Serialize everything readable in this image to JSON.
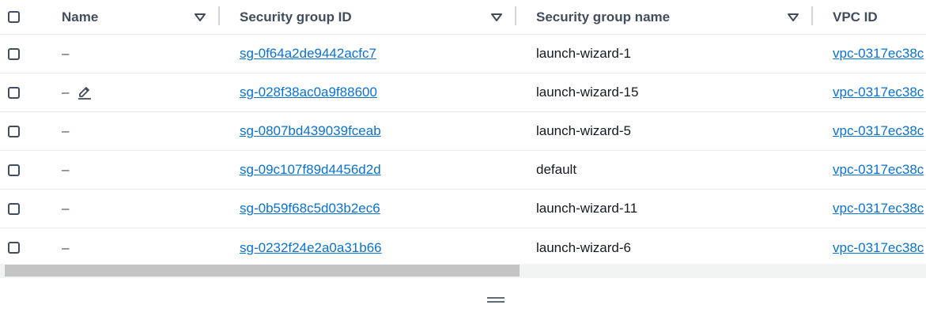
{
  "columns": {
    "name": "Name",
    "security_group_id": "Security group ID",
    "security_group_name": "Security group name",
    "vpc_id": "VPC ID"
  },
  "rows": [
    {
      "name": "–",
      "sg_id": "sg-0f64a2de9442acfc7",
      "sg_name": "launch-wizard-1",
      "vpc_id": "vpc-0317ec38c"
    },
    {
      "name": "–",
      "sg_id": "sg-028f38ac0a9f88600",
      "sg_name": "launch-wizard-15",
      "vpc_id": "vpc-0317ec38c"
    },
    {
      "name": "–",
      "sg_id": "sg-0807bd439039fceab",
      "sg_name": "launch-wizard-5",
      "vpc_id": "vpc-0317ec38c"
    },
    {
      "name": "–",
      "sg_id": "sg-09c107f89d4456d2d",
      "sg_name": "default",
      "vpc_id": "vpc-0317ec38c"
    },
    {
      "name": "–",
      "sg_id": "sg-0b59f68c5d03b2ec6",
      "sg_name": "launch-wizard-11",
      "vpc_id": "vpc-0317ec38c"
    },
    {
      "name": "–",
      "sg_id": "sg-0232f24e2a0a31b66",
      "sg_name": "launch-wizard-6",
      "vpc_id": "vpc-0317ec38c"
    }
  ],
  "icons": {
    "sort": "caret-down-icon",
    "edit": "pencil-icon",
    "resize": "drag-handle-icon"
  },
  "colors": {
    "link": "#0972d3",
    "header_text": "#414d5c",
    "row_border": "#e9ebed"
  }
}
